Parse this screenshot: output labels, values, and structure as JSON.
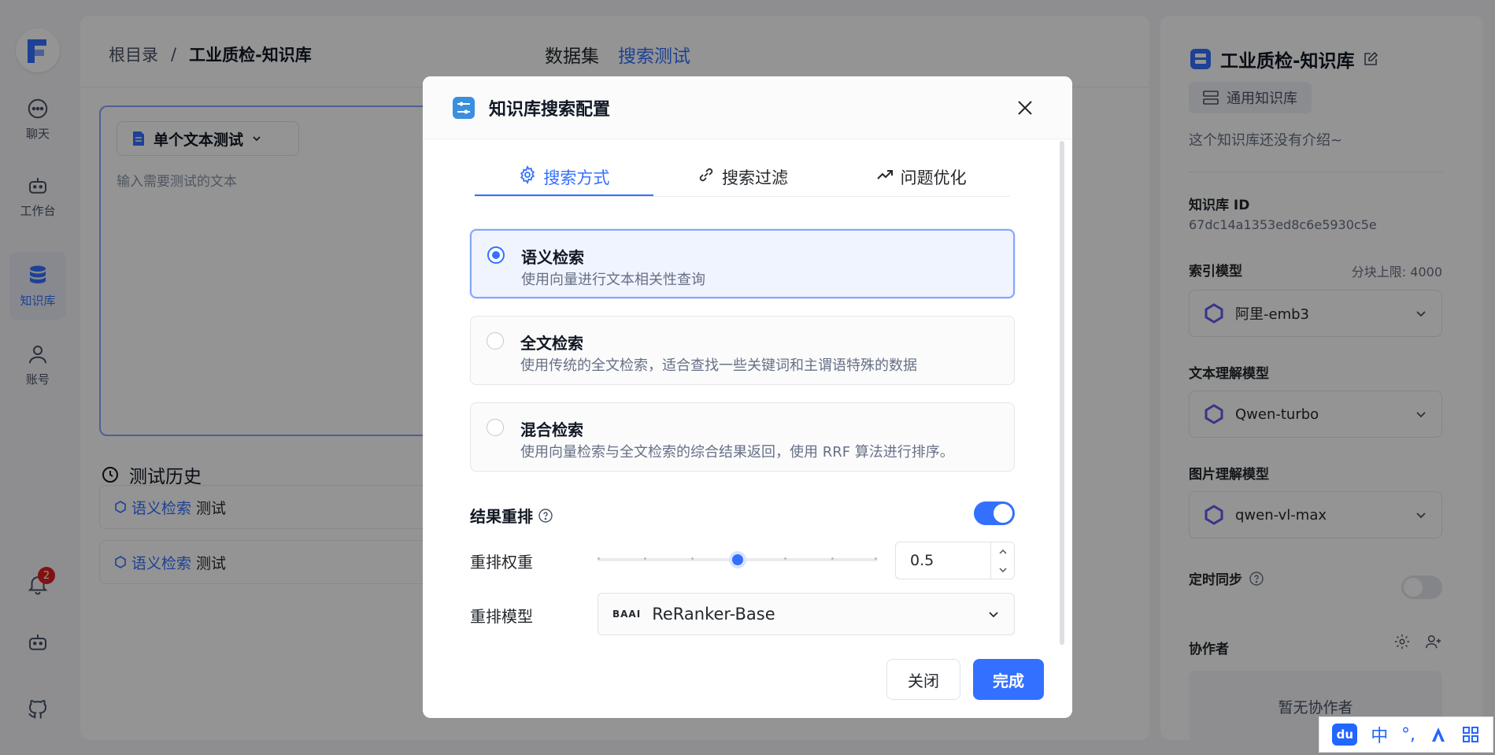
{
  "nav": {
    "items": [
      {
        "label": "聊天"
      },
      {
        "label": "工作台"
      },
      {
        "label": "知识库"
      },
      {
        "label": "账号"
      }
    ],
    "notification_count": "2"
  },
  "main": {
    "breadcrumb": {
      "root": "根目录",
      "sep": "/",
      "current": "工业质检-知识库"
    },
    "tabs": [
      "数据集",
      "搜索测试"
    ],
    "test_mode_label": "单个文本测试",
    "test_placeholder": "输入需要测试的文本",
    "history_title": "测试历史",
    "history": [
      {
        "tag": "语义检索",
        "text": "测试"
      },
      {
        "tag": "语义检索",
        "text": "测试"
      }
    ]
  },
  "right": {
    "title": "工业质检-知识库",
    "type_chip": "通用知识库",
    "intro": "这个知识库还没有介绍~",
    "id_label": "知识库 ID",
    "id_value": "67dc14a1353ed8c6e5930c5e",
    "index_model_label": "索引模型",
    "chunk_limit": "分块上限: 4000",
    "index_model": "阿里-emb3",
    "text_model_label": "文本理解模型",
    "text_model": "Qwen-turbo",
    "image_model_label": "图片理解模型",
    "image_model": "qwen-vl-max",
    "sync_label": "定时同步",
    "collab_label": "协作者",
    "collab_empty": "暂无协作者"
  },
  "modal": {
    "title": "知识库搜索配置",
    "tabs": [
      "搜索方式",
      "搜索过滤",
      "问题优化"
    ],
    "options": [
      {
        "title": "语义检索",
        "desc": "使用向量进行文本相关性查询",
        "selected": true
      },
      {
        "title": "全文检索",
        "desc": "使用传统的全文检索，适合查找一些关键词和主谓语特殊的数据",
        "selected": false
      },
      {
        "title": "混合检索",
        "desc": "使用向量检索与全文检索的综合结果返回，使用 RRF 算法进行排序。",
        "selected": false
      }
    ],
    "rerank_label": "结果重排",
    "rerank_enabled": true,
    "weight_label": "重排权重",
    "weight_value": "0.5",
    "weight_fraction": 0.5,
    "model_label": "重排模型",
    "model_brand": "BAAI",
    "model_value": "ReRanker-Base",
    "close_button": "关闭",
    "done_button": "完成"
  },
  "ime": {
    "lang": "中",
    "punct": "°,"
  },
  "colors": {
    "accent": "#3370ff",
    "overlay": "rgba(0,0,0,0.42)"
  }
}
